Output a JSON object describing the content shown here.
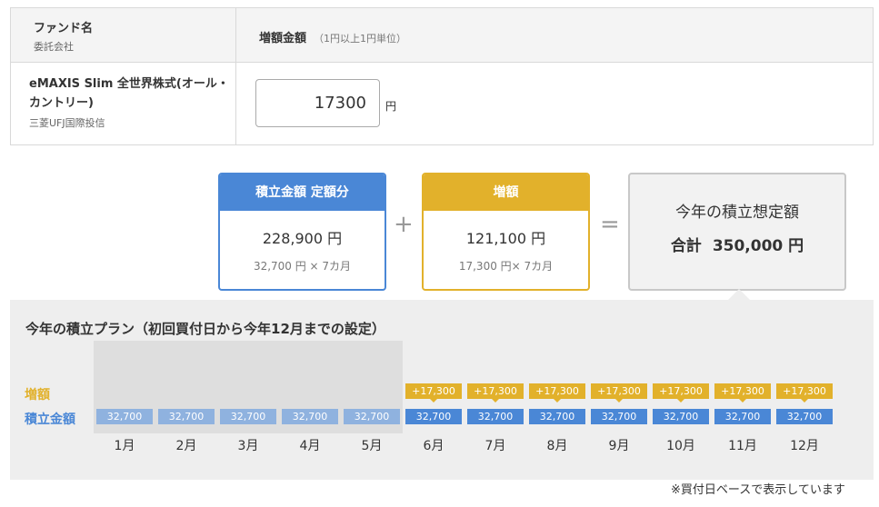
{
  "fund_table": {
    "header_fund": "ファンド名",
    "header_fund_sub": "委託会社",
    "header_amount": "増額金額",
    "header_amount_note": "（1円以上1円単位）",
    "fund_name": "eMAXIS Slim 全世界株式(オール・カントリー)",
    "company": "三菱UFJ国際投信",
    "input_value": "17300",
    "unit": "円"
  },
  "summary": {
    "base": {
      "title": "積立金額 定額分",
      "amount": "228,900 円",
      "calc": "32,700 円 × 7カ月"
    },
    "plus_sign": "+",
    "increase": {
      "title": "増額",
      "amount": "121,100 円",
      "calc": "17,300 円× 7カ月"
    },
    "equals_sign": "=",
    "total": {
      "title": "今年の積立想定額",
      "label": "合計",
      "amount": "350,000 円"
    }
  },
  "plan": {
    "title": "今年の積立プラン（初回買付日から今年12月までの設定）",
    "legend_increase": "増額",
    "legend_base": "積立金額",
    "months": [
      {
        "month": "1月",
        "base": "32,700",
        "increase": null,
        "past": true
      },
      {
        "month": "2月",
        "base": "32,700",
        "increase": null,
        "past": true
      },
      {
        "month": "3月",
        "base": "32,700",
        "increase": null,
        "past": true
      },
      {
        "month": "4月",
        "base": "32,700",
        "increase": null,
        "past": true
      },
      {
        "month": "5月",
        "base": "32,700",
        "increase": null,
        "past": true
      },
      {
        "month": "6月",
        "base": "32,700",
        "increase": "+17,300",
        "past": false
      },
      {
        "month": "7月",
        "base": "32,700",
        "increase": "+17,300",
        "past": false
      },
      {
        "month": "8月",
        "base": "32,700",
        "increase": "+17,300",
        "past": false
      },
      {
        "month": "9月",
        "base": "32,700",
        "increase": "+17,300",
        "past": false
      },
      {
        "month": "10月",
        "base": "32,700",
        "increase": "+17,300",
        "past": false
      },
      {
        "month": "11月",
        "base": "32,700",
        "increase": "+17,300",
        "past": false
      },
      {
        "month": "12月",
        "base": "32,700",
        "increase": "+17,300",
        "past": false
      }
    ]
  },
  "footnote": "※買付日ベースで表示しています",
  "colors": {
    "base": "#4a87d6",
    "increase": "#e2b12b",
    "past_base": "#8fb2df"
  }
}
